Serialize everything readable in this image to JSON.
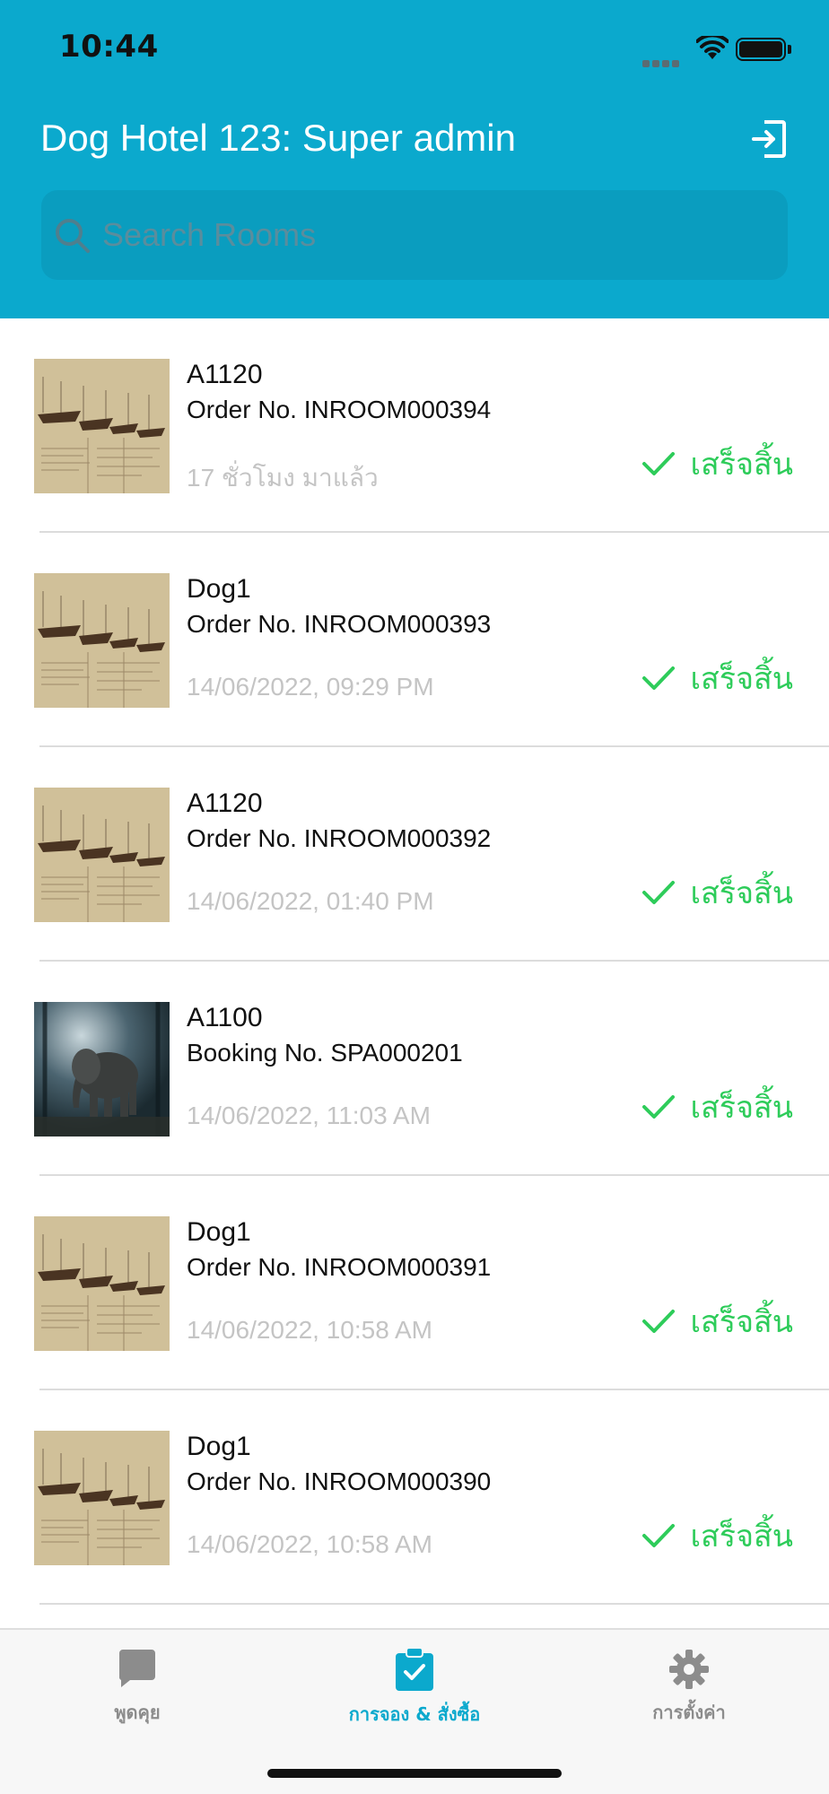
{
  "status_bar": {
    "time": "10:44"
  },
  "header": {
    "title": "Dog Hotel 123: Super admin",
    "logout_icon": "logout-icon"
  },
  "search": {
    "placeholder": "Search Rooms",
    "value": "",
    "icon": "search-icon"
  },
  "orders": [
    {
      "name": "A1120",
      "number": "Order No. INROOM000394",
      "time": "17 ชั่วโมง มาแล้ว",
      "status": "เสร็จสิ้น",
      "thumbnail": "sailing-ship-sketch"
    },
    {
      "name": "Dog1",
      "number": "Order No. INROOM000393",
      "time": "14/06/2022, 09:29 PM",
      "status": "เสร็จสิ้น",
      "thumbnail": "sailing-ship-sketch"
    },
    {
      "name": "A1120",
      "number": "Order No. INROOM000392",
      "time": "14/06/2022, 01:40 PM",
      "status": "เสร็จสิ้น",
      "thumbnail": "sailing-ship-sketch"
    },
    {
      "name": "A1100",
      "number": "Booking No. SPA000201",
      "time": "14/06/2022, 11:03 AM",
      "status": "เสร็จสิ้น",
      "thumbnail": "elephant-forest-photo"
    },
    {
      "name": "Dog1",
      "number": "Order No. INROOM000391",
      "time": "14/06/2022, 10:58 AM",
      "status": "เสร็จสิ้น",
      "thumbnail": "sailing-ship-sketch"
    },
    {
      "name": "Dog1",
      "number": "Order No. INROOM000390",
      "time": "14/06/2022, 10:58 AM",
      "status": "เสร็จสิ้น",
      "thumbnail": "sailing-ship-sketch"
    }
  ],
  "tabs": [
    {
      "label": "พูดคุย",
      "icon": "chat-bubble-icon",
      "active": false
    },
    {
      "label": "การจอง & สั่งซื้อ",
      "icon": "clipboard-check-icon",
      "active": true
    },
    {
      "label": "การตั้งค่า",
      "icon": "gear-icon",
      "active": false
    }
  ],
  "colors": {
    "header": "#0ba9cd",
    "status_done": "#2ecc5a",
    "tab_active": "#0ba9cd",
    "tab_inactive": "#8c8c8c"
  }
}
